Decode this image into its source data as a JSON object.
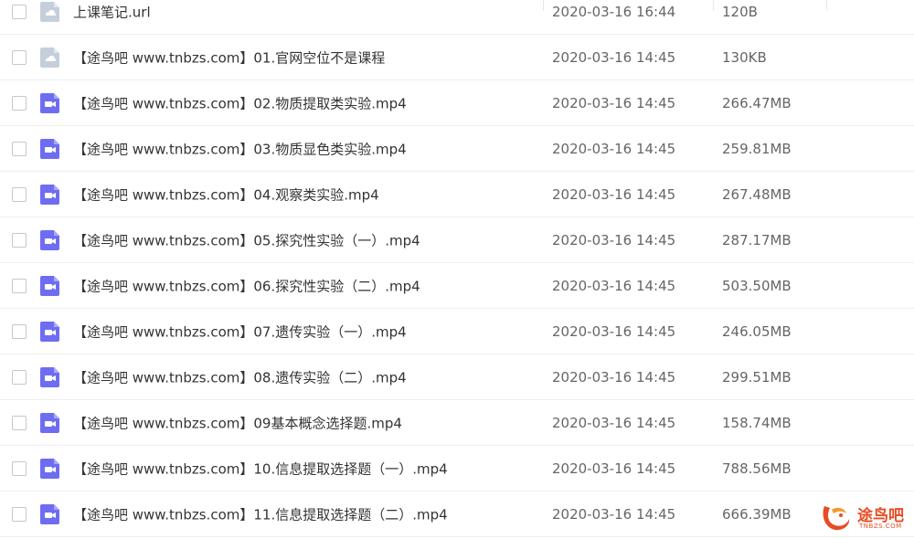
{
  "files": [
    {
      "icon": "link-file-icon",
      "name": "上课笔记.url",
      "date": "2020-03-16 16:44",
      "size": "120B"
    },
    {
      "icon": "link-file-icon",
      "name": "【途鸟吧 www.tnbzs.com】01.官网空位不是课程",
      "date": "2020-03-16 14:45",
      "size": "130KB"
    },
    {
      "icon": "video-file-icon",
      "name": "【途鸟吧 www.tnbzs.com】02.物质提取类实验.mp4",
      "date": "2020-03-16 14:45",
      "size": "266.47MB"
    },
    {
      "icon": "video-file-icon",
      "name": "【途鸟吧 www.tnbzs.com】03.物质显色类实验.mp4",
      "date": "2020-03-16 14:45",
      "size": "259.81MB"
    },
    {
      "icon": "video-file-icon",
      "name": "【途鸟吧 www.tnbzs.com】04.观察类实验.mp4",
      "date": "2020-03-16 14:45",
      "size": "267.48MB"
    },
    {
      "icon": "video-file-icon",
      "name": "【途鸟吧 www.tnbzs.com】05.探究性实验（一）.mp4",
      "date": "2020-03-16 14:45",
      "size": "287.17MB"
    },
    {
      "icon": "video-file-icon",
      "name": "【途鸟吧 www.tnbzs.com】06.探究性实验（二）.mp4",
      "date": "2020-03-16 14:45",
      "size": "503.50MB"
    },
    {
      "icon": "video-file-icon",
      "name": "【途鸟吧 www.tnbzs.com】07.遗传实验（一）.mp4",
      "date": "2020-03-16 14:45",
      "size": "246.05MB"
    },
    {
      "icon": "video-file-icon",
      "name": "【途鸟吧 www.tnbzs.com】08.遗传实验（二）.mp4",
      "date": "2020-03-16 14:45",
      "size": "299.51MB"
    },
    {
      "icon": "video-file-icon",
      "name": "【途鸟吧 www.tnbzs.com】09基本概念选择题.mp4",
      "date": "2020-03-16 14:45",
      "size": "158.74MB"
    },
    {
      "icon": "video-file-icon",
      "name": "【途鸟吧 www.tnbzs.com】10.信息提取选择题（一）.mp4",
      "date": "2020-03-16 14:45",
      "size": "788.56MB"
    },
    {
      "icon": "video-file-icon",
      "name": "【途鸟吧 www.tnbzs.com】11.信息提取选择题（二）.mp4",
      "date": "2020-03-16 14:45",
      "size": "666.39MB"
    }
  ],
  "watermark": {
    "text": "途鸟吧",
    "url": "TNBZS.COM"
  },
  "colors": {
    "video_icon": "#6e6df2",
    "link_icon": "#c5cfdb",
    "watermark": "#e74c24"
  }
}
